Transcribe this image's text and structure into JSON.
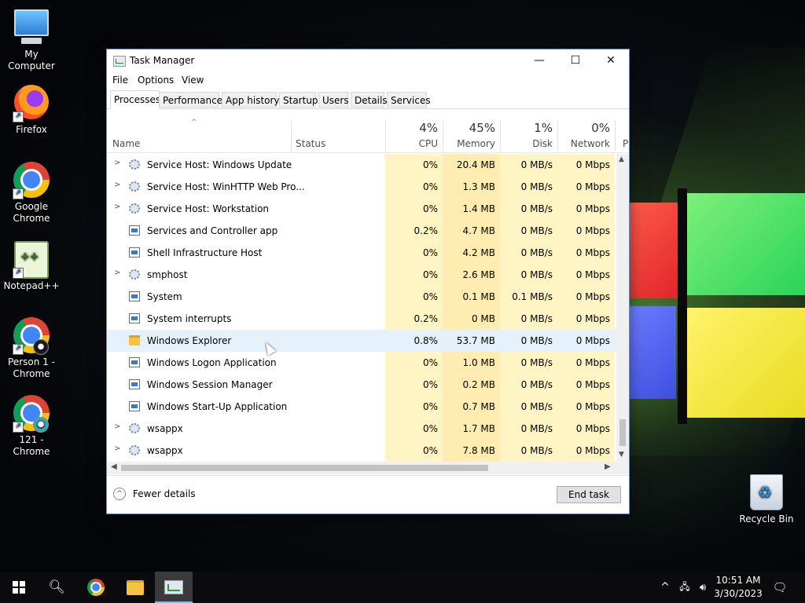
{
  "desktop": {
    "icons": [
      {
        "label": "My Computer"
      },
      {
        "label": "Firefox"
      },
      {
        "label": "Google Chrome"
      },
      {
        "label": "Notepad++"
      },
      {
        "label": "Person 1 - Chrome"
      },
      {
        "label": "121 - Chrome"
      },
      {
        "label": "Recycle Bin"
      }
    ]
  },
  "window": {
    "title": "Task Manager",
    "controls": {
      "minimize": "—",
      "maximize": "☐",
      "close": "✕"
    },
    "menu": [
      "File",
      "Options",
      "View"
    ],
    "tabs": [
      "Processes",
      "Performance",
      "App history",
      "Startup",
      "Users",
      "Details",
      "Services"
    ],
    "selected_tab": "Processes",
    "columns": {
      "name": "Name",
      "status": "Status",
      "cpu": {
        "pct": "4%",
        "label": "CPU"
      },
      "memory": {
        "pct": "45%",
        "label": "Memory"
      },
      "disk": {
        "pct": "1%",
        "label": "Disk"
      },
      "network": {
        "pct": "0%",
        "label": "Network"
      },
      "overflow": "P"
    },
    "rows": [
      {
        "name": "Service Host: Windows Update",
        "cpu": "0%",
        "mem": "20.4 MB",
        "disk": "0 MB/s",
        "net": "0 Mbps",
        "icon": "gear-icon",
        "expandable": true
      },
      {
        "name": "Service Host: WinHTTP Web Pro...",
        "cpu": "0%",
        "mem": "1.3 MB",
        "disk": "0 MB/s",
        "net": "0 Mbps",
        "icon": "gear-icon",
        "expandable": true
      },
      {
        "name": "Service Host: Workstation",
        "cpu": "0%",
        "mem": "1.4 MB",
        "disk": "0 MB/s",
        "net": "0 Mbps",
        "icon": "gear-icon",
        "expandable": true
      },
      {
        "name": "Services and Controller app",
        "cpu": "0.2%",
        "mem": "4.7 MB",
        "disk": "0 MB/s",
        "net": "0 Mbps",
        "icon": "app-window-icon",
        "expandable": false
      },
      {
        "name": "Shell Infrastructure Host",
        "cpu": "0%",
        "mem": "4.2 MB",
        "disk": "0 MB/s",
        "net": "0 Mbps",
        "icon": "app-window-icon",
        "expandable": false
      },
      {
        "name": "smphost",
        "cpu": "0%",
        "mem": "2.6 MB",
        "disk": "0 MB/s",
        "net": "0 Mbps",
        "icon": "gear-icon",
        "expandable": true
      },
      {
        "name": "System",
        "cpu": "0%",
        "mem": "0.1 MB",
        "disk": "0.1 MB/s",
        "net": "0 Mbps",
        "icon": "app-window-icon",
        "expandable": false
      },
      {
        "name": "System interrupts",
        "cpu": "0.2%",
        "mem": "0 MB",
        "disk": "0 MB/s",
        "net": "0 Mbps",
        "icon": "app-window-icon",
        "expandable": false
      },
      {
        "name": "Windows Explorer",
        "cpu": "0.8%",
        "mem": "53.7 MB",
        "disk": "0 MB/s",
        "net": "0 Mbps",
        "icon": "folder-icon",
        "expandable": false
      },
      {
        "name": "Windows Logon Application",
        "cpu": "0%",
        "mem": "1.0 MB",
        "disk": "0 MB/s",
        "net": "0 Mbps",
        "icon": "app-window-icon",
        "expandable": false
      },
      {
        "name": "Windows Session Manager",
        "cpu": "0%",
        "mem": "0.2 MB",
        "disk": "0 MB/s",
        "net": "0 Mbps",
        "icon": "app-window-icon",
        "expandable": false
      },
      {
        "name": "Windows Start-Up Application",
        "cpu": "0%",
        "mem": "0.7 MB",
        "disk": "0 MB/s",
        "net": "0 Mbps",
        "icon": "app-window-icon",
        "expandable": false
      },
      {
        "name": "wsappx",
        "cpu": "0%",
        "mem": "1.7 MB",
        "disk": "0 MB/s",
        "net": "0 Mbps",
        "icon": "gear-icon",
        "expandable": true
      },
      {
        "name": "wsappx",
        "cpu": "0%",
        "mem": "7.8 MB",
        "disk": "0 MB/s",
        "net": "0 Mbps",
        "icon": "gear-icon",
        "expandable": true
      }
    ],
    "hovered_row": "Windows Explorer",
    "footer": {
      "fewer_details": "Fewer details",
      "end_task": "End task"
    }
  },
  "taskbar": {
    "time": "10:51 AM",
    "date": "3/30/2023",
    "pinned": [
      "start-button",
      "search-icon",
      "chrome-icon",
      "file-explorer-icon",
      "task-manager-icon"
    ]
  },
  "colors": {
    "cpu_heat": "#fff4c4",
    "mem_heat": "#ffecb0",
    "hover_row": "#e5f1fb",
    "accent": "#0078d7"
  }
}
